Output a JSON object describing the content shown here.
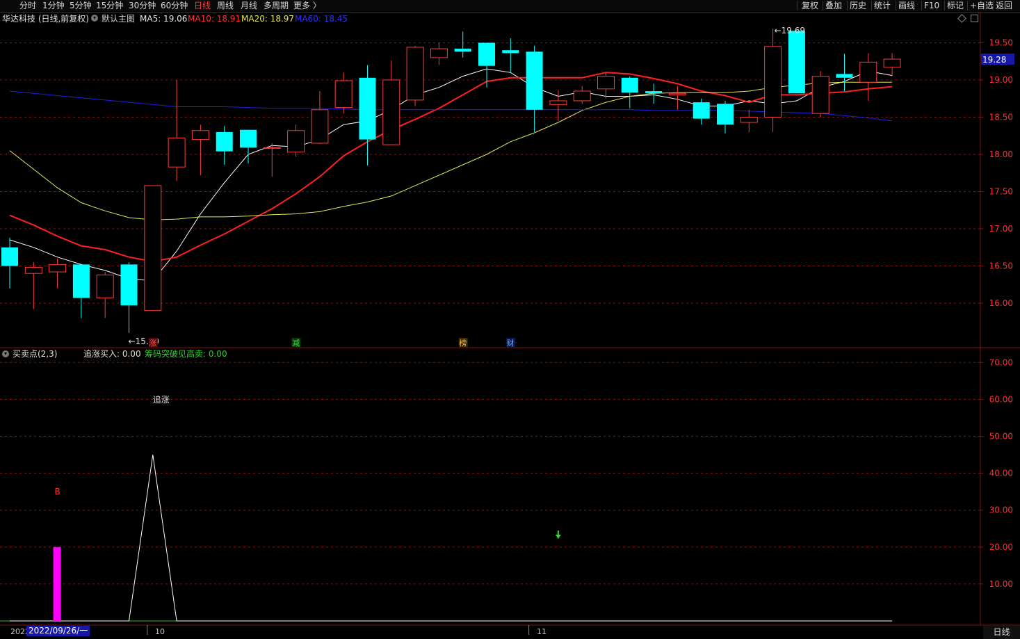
{
  "toolbar": {
    "periods": [
      "分时",
      "1分钟",
      "5分钟",
      "15分钟",
      "30分钟",
      "60分钟",
      "日线",
      "周线",
      "月线",
      "多周期",
      "更多 〉"
    ],
    "active_period": "日线",
    "right_buttons": [
      "复权",
      "叠加",
      "历史",
      "统计",
      "画线",
      "F10",
      "标记",
      "+自选",
      "返回"
    ]
  },
  "main_info": {
    "stock": "华达科技 (日线,前复权)",
    "template": "默认主图",
    "ma5": "MA5: 19.06",
    "ma10": "MA10: 18.91",
    "ma20": "MA20: 18.97",
    "ma60": "MA60: 18.45"
  },
  "colors": {
    "up": "#ff3c3c",
    "down": "#00ffff",
    "ma5": "#ffffff",
    "ma10": "#ff2020",
    "ma20": "#e8e858",
    "ma60": "#2020e0",
    "grid": "#8a1010",
    "axis_text": "#ff3030"
  },
  "indicator_info": {
    "name": "买卖点(2,3)",
    "buy_label": "追涨买入: 0.00",
    "sell_label": "筹码突破见高卖: 0.00"
  },
  "annotations": {
    "low": "←15.60",
    "high": "←19.69",
    "current_price": "19.28",
    "chase_text": "追涨",
    "b_text": "B",
    "event_tags": [
      "涨",
      "减",
      "榜",
      "财"
    ]
  },
  "xaxis": {
    "labels": [
      "2022",
      "10",
      "11"
    ],
    "cursor_date": "2022/09/26/一",
    "period": "日线"
  },
  "chart_data": [
    {
      "type": "candlestick",
      "title": "华达科技 (日线,前复权)",
      "ylim": [
        15.4,
        19.9
      ],
      "yticks": [
        "16.00",
        "16.50",
        "17.00",
        "17.50",
        "18.00",
        "18.50",
        "19.00",
        "19.50"
      ],
      "candles": [
        {
          "o": 16.75,
          "c": 16.5,
          "h": 16.88,
          "l": 16.2
        },
        {
          "o": 16.4,
          "c": 16.48,
          "h": 16.55,
          "l": 15.92
        },
        {
          "o": 16.42,
          "c": 16.52,
          "h": 16.6,
          "l": 16.2
        },
        {
          "o": 16.52,
          "c": 16.07,
          "h": 16.52,
          "l": 15.8
        },
        {
          "o": 16.07,
          "c": 16.38,
          "h": 16.42,
          "l": 15.8
        },
        {
          "o": 16.52,
          "c": 15.97,
          "h": 16.55,
          "l": 15.6
        },
        {
          "o": 15.9,
          "c": 17.58,
          "h": 17.58,
          "l": 15.9
        },
        {
          "o": 17.83,
          "c": 18.22,
          "h": 19.0,
          "l": 17.64
        },
        {
          "o": 18.2,
          "c": 18.32,
          "h": 18.4,
          "l": 17.72
        },
        {
          "o": 18.3,
          "c": 18.04,
          "h": 18.38,
          "l": 17.86
        },
        {
          "o": 18.33,
          "c": 18.09,
          "h": 18.33,
          "l": 17.88
        },
        {
          "o": 18.09,
          "c": 18.09,
          "h": 18.15,
          "l": 17.7
        },
        {
          "o": 18.03,
          "c": 18.32,
          "h": 18.4,
          "l": 17.97
        },
        {
          "o": 18.15,
          "c": 18.6,
          "h": 18.85,
          "l": 18.14
        },
        {
          "o": 18.63,
          "c": 18.99,
          "h": 19.1,
          "l": 18.55
        },
        {
          "o": 19.03,
          "c": 18.2,
          "h": 19.2,
          "l": 17.85
        },
        {
          "o": 18.13,
          "c": 19.0,
          "h": 19.26,
          "l": 18.13
        },
        {
          "o": 18.73,
          "c": 19.44,
          "h": 19.46,
          "l": 18.65
        },
        {
          "o": 19.3,
          "c": 19.42,
          "h": 19.5,
          "l": 19.2
        },
        {
          "o": 19.42,
          "c": 19.38,
          "h": 19.65,
          "l": 19.3
        },
        {
          "o": 19.5,
          "c": 19.19,
          "h": 19.5,
          "l": 18.9
        },
        {
          "o": 19.4,
          "c": 19.36,
          "h": 19.56,
          "l": 19.1
        },
        {
          "o": 19.38,
          "c": 18.6,
          "h": 19.46,
          "l": 18.3
        },
        {
          "o": 18.67,
          "c": 18.72,
          "h": 18.86,
          "l": 18.45
        },
        {
          "o": 18.72,
          "c": 18.85,
          "h": 18.92,
          "l": 18.68
        },
        {
          "o": 18.88,
          "c": 19.05,
          "h": 19.1,
          "l": 18.75
        },
        {
          "o": 19.03,
          "c": 18.83,
          "h": 19.05,
          "l": 18.62
        },
        {
          "o": 18.85,
          "c": 18.82,
          "h": 18.95,
          "l": 18.68
        },
        {
          "o": 18.8,
          "c": 18.82,
          "h": 18.92,
          "l": 18.6
        },
        {
          "o": 18.7,
          "c": 18.48,
          "h": 18.75,
          "l": 18.4
        },
        {
          "o": 18.68,
          "c": 18.4,
          "h": 18.72,
          "l": 18.28
        },
        {
          "o": 18.43,
          "c": 18.5,
          "h": 18.6,
          "l": 18.3
        },
        {
          "o": 18.5,
          "c": 19.45,
          "h": 19.69,
          "l": 18.3
        },
        {
          "o": 19.66,
          "c": 18.82,
          "h": 19.66,
          "l": 18.82
        },
        {
          "o": 18.55,
          "c": 19.05,
          "h": 19.12,
          "l": 18.5
        },
        {
          "o": 19.08,
          "c": 19.03,
          "h": 19.35,
          "l": 18.85
        },
        {
          "o": 18.97,
          "c": 19.24,
          "h": 19.36,
          "l": 18.72
        },
        {
          "o": 19.17,
          "c": 19.28,
          "h": 19.36,
          "l": 19.05
        }
      ],
      "series": [
        {
          "name": "MA5",
          "values": [
            16.85,
            16.75,
            16.62,
            16.52,
            16.44,
            16.33,
            16.3,
            16.7,
            17.2,
            17.62,
            18.0,
            18.12,
            18.1,
            18.2,
            18.4,
            18.45,
            18.6,
            18.8,
            18.9,
            19.05,
            19.15,
            19.1,
            18.9,
            18.78,
            18.84,
            18.78,
            18.78,
            18.8,
            18.74,
            18.65,
            18.65,
            18.72,
            18.68,
            18.72,
            18.9,
            18.98,
            19.12,
            19.06
          ]
        },
        {
          "name": "MA10",
          "values": [
            17.18,
            17.05,
            16.9,
            16.77,
            16.72,
            16.62,
            16.56,
            16.62,
            16.78,
            16.93,
            17.1,
            17.27,
            17.47,
            17.7,
            17.98,
            18.17,
            18.33,
            18.47,
            18.62,
            18.8,
            18.98,
            19.03,
            19.03,
            19.03,
            19.03,
            19.1,
            19.08,
            19.02,
            18.95,
            18.85,
            18.79,
            18.7,
            18.8,
            18.8,
            18.82,
            18.84,
            18.88,
            18.91
          ]
        },
        {
          "name": "MA20",
          "values": [
            18.05,
            17.8,
            17.55,
            17.35,
            17.24,
            17.15,
            17.12,
            17.13,
            17.16,
            17.16,
            17.17,
            17.19,
            17.2,
            17.23,
            17.3,
            17.36,
            17.44,
            17.58,
            17.72,
            17.86,
            18.0,
            18.17,
            18.29,
            18.43,
            18.59,
            18.7,
            18.78,
            18.82,
            18.83,
            18.83,
            18.83,
            18.85,
            18.9,
            18.93,
            18.96,
            18.97,
            18.97,
            18.97
          ]
        },
        {
          "name": "MA60",
          "values": [
            18.85,
            18.82,
            18.79,
            18.76,
            18.73,
            18.7,
            18.67,
            18.64,
            18.64,
            18.64,
            18.63,
            18.62,
            18.62,
            18.62,
            18.61,
            18.6,
            18.6,
            18.6,
            18.6,
            18.6,
            18.6,
            18.6,
            18.6,
            18.6,
            18.6,
            18.6,
            18.6,
            18.59,
            18.59,
            18.59,
            18.59,
            18.58,
            18.57,
            18.56,
            18.55,
            18.52,
            18.49,
            18.45
          ]
        }
      ]
    },
    {
      "type": "line",
      "title": "买卖点(2,3)",
      "ylim": [
        0,
        71
      ],
      "yticks": [
        "10.00",
        "20.00",
        "30.00",
        "40.00",
        "50.00",
        "60.00",
        "70.00"
      ],
      "series": [
        {
          "name": "追涨买入",
          "type": "line",
          "values": [
            0,
            0,
            0,
            0,
            0,
            0,
            45,
            0,
            0,
            0,
            0,
            0,
            0,
            0,
            0,
            0,
            0,
            0,
            0,
            0,
            0,
            0,
            0,
            0,
            0,
            0,
            0,
            0,
            0,
            0,
            0,
            0,
            0,
            0,
            0,
            0,
            0,
            0
          ]
        },
        {
          "name": "B",
          "type": "bar",
          "values": [
            0,
            0,
            20,
            0,
            0,
            0,
            0,
            0,
            0,
            0,
            0,
            0,
            0,
            0,
            0,
            0,
            0,
            0,
            0,
            0,
            0,
            0,
            0,
            0,
            0,
            0,
            0,
            0,
            0,
            0,
            0,
            0,
            0,
            0,
            0,
            0,
            0,
            0
          ]
        }
      ],
      "sell_signal_index": 23
    }
  ]
}
